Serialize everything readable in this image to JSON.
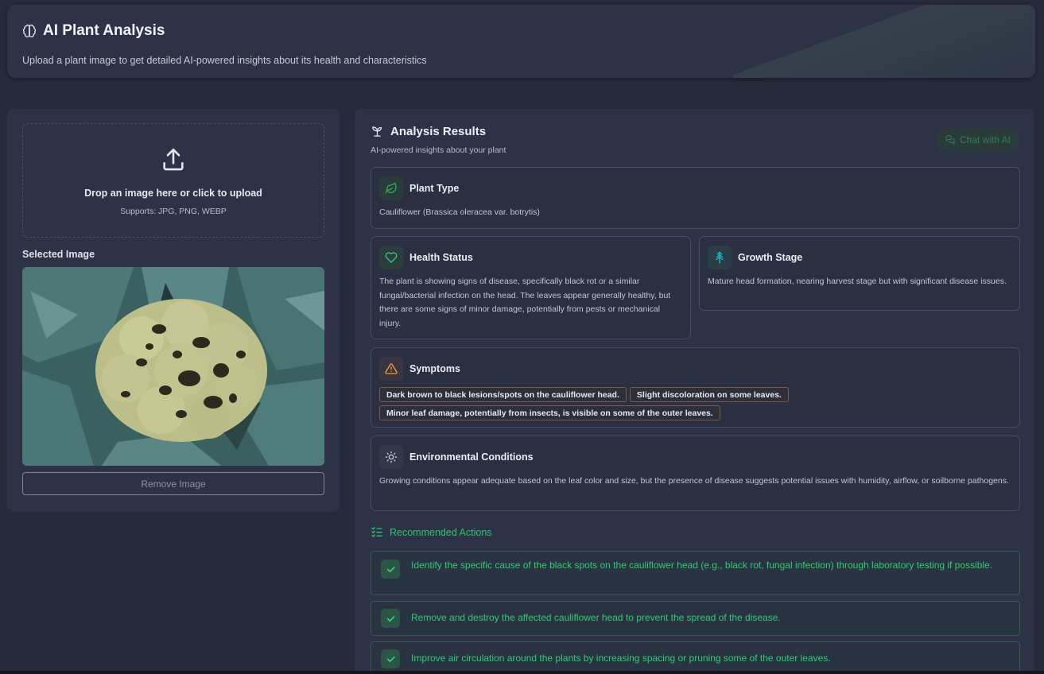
{
  "header": {
    "title": "AI Plant Analysis",
    "subtitle": "Upload a plant image to get detailed AI-powered insights about its health and characteristics",
    "icon": "brain-icon"
  },
  "upload": {
    "icon": "upload-icon",
    "title": "Drop an image here or click to upload",
    "supports": "Supports: JPG, PNG, WEBP",
    "selected_label": "Selected Image",
    "remove_label": "Remove Image"
  },
  "results": {
    "title": "Analysis Results",
    "subtitle": "AI-powered insights about your plant",
    "chat_label": "Chat with AI",
    "plant_type": {
      "label": "Plant Type",
      "value": "Cauliflower (Brassica oleracea var. botrytis)"
    },
    "health_status": {
      "label": "Health Status",
      "value": "The plant is showing signs of disease, specifically black rot or a similar fungal/bacterial infection on the head. The leaves appear generally healthy, but there are some signs of minor damage, potentially from pests or mechanical injury."
    },
    "growth_stage": {
      "label": "Growth Stage",
      "value": "Mature head formation, nearing harvest stage but with significant disease issues."
    },
    "symptoms": {
      "label": "Symptoms",
      "items": [
        "Dark brown to black lesions/spots on the cauliflower head.",
        "Slight discoloration on some leaves.",
        "Minor leaf damage, potentially from insects, is visible on some of the outer leaves."
      ]
    },
    "environment": {
      "label": "Environmental Conditions",
      "value": "Growing conditions appear adequate based on the leaf color and size, but the presence of disease suggests potential issues with humidity, airflow, or soilborne pathogens."
    },
    "recommended": {
      "label": "Recommended Actions",
      "items": [
        "Identify the specific cause of the black spots on the cauliflower head (e.g., black rot, fungal infection) through laboratory testing if possible.",
        "Remove and destroy the affected cauliflower head to prevent the spread of the disease.",
        "Improve air circulation around the plants by increasing spacing or pruning some of the outer leaves."
      ]
    }
  },
  "colors": {
    "background": "#262a3b",
    "card": "#2d3246",
    "accent_green": "#2ecc71",
    "warning_orange": "#f39c3c",
    "teal": "#1fb8c8"
  }
}
